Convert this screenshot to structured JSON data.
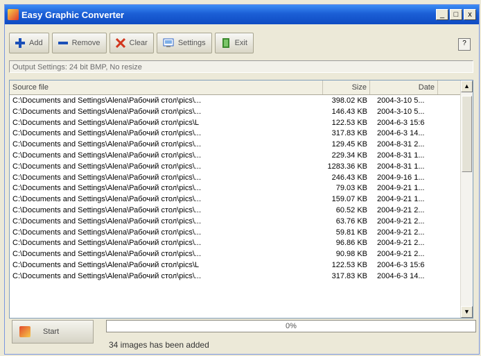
{
  "window": {
    "title": "Easy Graphic Converter",
    "minimize": "_",
    "maximize": "□",
    "close": "x"
  },
  "toolbar": {
    "add": "Add",
    "remove": "Remove",
    "clear": "Clear",
    "settings": "Settings",
    "exit": "Exit",
    "help": "?"
  },
  "output_settings": "Output Settings: 24 bit BMP, No resize",
  "list": {
    "headers": {
      "source": "Source file",
      "size": "Size",
      "date": "Date"
    },
    "rows": [
      {
        "path": "C:\\Documents and Settings\\Alena\\Рабочий стол\\pics\\...",
        "size": "398.02 KB",
        "date": "2004-3-10 5..."
      },
      {
        "path": "C:\\Documents and Settings\\Alena\\Рабочий стол\\pics\\...",
        "size": "146.43 KB",
        "date": "2004-3-10 5..."
      },
      {
        "path": "C:\\Documents and Settings\\Alena\\Рабочий стол\\pics\\L",
        "size": "122.53 KB",
        "date": "2004-6-3 15:6"
      },
      {
        "path": "C:\\Documents and Settings\\Alena\\Рабочий стол\\pics\\...",
        "size": "317.83 KB",
        "date": "2004-6-3 14..."
      },
      {
        "path": "C:\\Documents and Settings\\Alena\\Рабочий стол\\pics\\...",
        "size": "129.45 KB",
        "date": "2004-8-31 2..."
      },
      {
        "path": "C:\\Documents and Settings\\Alena\\Рабочий стол\\pics\\...",
        "size": "229.34 KB",
        "date": "2004-8-31 1..."
      },
      {
        "path": "C:\\Documents and Settings\\Alena\\Рабочий стол\\pics\\...",
        "size": "1283.36 KB",
        "date": "2004-8-31 1..."
      },
      {
        "path": "C:\\Documents and Settings\\Alena\\Рабочий стол\\pics\\...",
        "size": "246.43 KB",
        "date": "2004-9-16 1..."
      },
      {
        "path": "C:\\Documents and Settings\\Alena\\Рабочий стол\\pics\\...",
        "size": "79.03 KB",
        "date": "2004-9-21 1..."
      },
      {
        "path": "C:\\Documents and Settings\\Alena\\Рабочий стол\\pics\\...",
        "size": "159.07 KB",
        "date": "2004-9-21 1..."
      },
      {
        "path": "C:\\Documents and Settings\\Alena\\Рабочий стол\\pics\\...",
        "size": "60.52 KB",
        "date": "2004-9-21 2..."
      },
      {
        "path": "C:\\Documents and Settings\\Alena\\Рабочий стол\\pics\\...",
        "size": "63.76 KB",
        "date": "2004-9-21 2..."
      },
      {
        "path": "C:\\Documents and Settings\\Alena\\Рабочий стол\\pics\\...",
        "size": "59.81 KB",
        "date": "2004-9-21 2..."
      },
      {
        "path": "C:\\Documents and Settings\\Alena\\Рабочий стол\\pics\\...",
        "size": "96.86 KB",
        "date": "2004-9-21 2..."
      },
      {
        "path": "C:\\Documents and Settings\\Alena\\Рабочий стол\\pics\\...",
        "size": "90.98 KB",
        "date": "2004-9-21 2..."
      },
      {
        "path": "C:\\Documents and Settings\\Alena\\Рабочий стол\\pics\\L",
        "size": "122.53 KB",
        "date": "2004-6-3 15:6"
      },
      {
        "path": "C:\\Documents and Settings\\Alena\\Рабочий стол\\pics\\...",
        "size": "317.83 KB",
        "date": "2004-6-3 14..."
      }
    ]
  },
  "start": {
    "label": "Start"
  },
  "progress": {
    "text": "0%",
    "value": 0
  },
  "status": "34 images has been added",
  "colors": {
    "titlebar": "#1b5fd6",
    "window_bg": "#ece9d8",
    "list_bg": "#ffffff"
  },
  "icons": {
    "add": "plus-icon",
    "remove": "minus-icon",
    "clear": "x-icon",
    "settings": "settings-icon",
    "exit": "door-icon",
    "start": "start-icon"
  }
}
